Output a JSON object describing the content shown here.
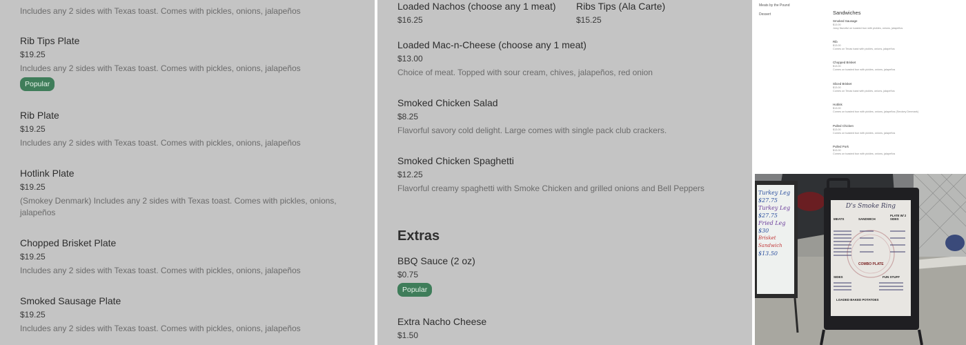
{
  "left_panel": {
    "top_desc": "Includes any 2 sides with Texas toast. Comes with pickles, onions, jalapeños",
    "items": [
      {
        "name": "Rib Tips Plate",
        "price": "$19.25",
        "desc": "Includes any 2 sides with Texas toast. Comes with pickles, onions, jalapeños",
        "badge": "Popular"
      },
      {
        "name": "Rib Plate",
        "price": "$19.25",
        "desc": "Includes any 2 sides with Texas toast. Comes with pickles, onions, jalapeños"
      },
      {
        "name": "Hotlink Plate",
        "price": "$19.25",
        "desc": "(Smokey Denmark) Includes any 2 sides with Texas toast. Comes with pickles, onions, jalapeños"
      },
      {
        "name": "Chopped Brisket Plate",
        "price": "$19.25",
        "desc": "Includes any 2 sides with Texas toast. Comes with pickles, onions, jalapeños"
      },
      {
        "name": "Smoked Sausage Plate",
        "price": "$19.25",
        "desc": "Includes any 2 sides with Texas toast. Comes with pickles, onions, jalapeños"
      }
    ]
  },
  "middle_panel": {
    "pair": [
      {
        "name": "Loaded Nachos (choose any 1 meat)",
        "price": "$16.25"
      },
      {
        "name": "Ribs Tips (Ala Carte)",
        "price": "$15.25"
      }
    ],
    "items": [
      {
        "name": "Loaded Mac-n-Cheese (choose any 1 meat)",
        "price": "$13.00",
        "desc": "Choice of meat. Topped with sour cream, chives, jalapeños, red onion"
      },
      {
        "name": "Smoked Chicken Salad",
        "price": "$8.25",
        "desc": "Flavorful savory cold delight. Large comes with single pack club crackers."
      },
      {
        "name": "Smoked Chicken Spaghetti",
        "price": "$12.25",
        "desc": "Flavorful creamy spaghetti with Smoke Chicken and grilled onions and Bell Peppers"
      }
    ],
    "section_title": "Extras",
    "extras": [
      {
        "name": "BBQ Sauce (2 oz)",
        "price": "$0.75",
        "badge": "Popular"
      },
      {
        "name": "Extra Nacho Cheese",
        "price": "$1.50"
      }
    ]
  },
  "thumbnail": {
    "categories": [
      "Meats by the Pound",
      "Dessert"
    ],
    "title": "Sandwiches",
    "items": [
      {
        "name": "Smoked Sausage",
        "price": "$13.00",
        "desc": "Juicy flavorful on toasted bun with pickles, onions, jalapeños"
      },
      {
        "name": "Rib",
        "price": "$13.00",
        "desc": "Comes on Texas toast with pickles, onions, jalapeños"
      },
      {
        "name": "Chopped Brisket",
        "price": "$13.00",
        "desc": "Comes on toasted bun with pickles, onions, jalapeños"
      },
      {
        "name": "Sliced Brisket",
        "price": "$13.00",
        "desc": "Comes on Texas toast with pickles, onions, jalapeños"
      },
      {
        "name": "Hotlink",
        "price": "$13.00",
        "desc": "Comes on toasted bun with pickles, onions, jalapeños (Smokey Denmark)"
      },
      {
        "name": "Pulled Chicken",
        "price": "$13.00",
        "desc": "Comes on toasted bun with pickles, onions, jalapeños"
      },
      {
        "name": "Pulled Pork",
        "price": "$13.00",
        "desc": "Comes on toasted bun with pickles, onions, jalapeños"
      }
    ]
  },
  "photo": {
    "whiteboard_lines": [
      "Turkey Leg",
      "$27.75",
      "Turkey Leg",
      "$27.75",
      "Fried Leg",
      "$30",
      "Brisket Sandwich",
      "$13.50"
    ],
    "sign_title": "D's Smoke Ring",
    "sign_headers": [
      "MEATS",
      "SANDWICH",
      "PLATE W/ 2 SIDES"
    ],
    "sign_sections": [
      "COMBO PLATE",
      "SIDES",
      "FUN STUFF",
      "LOADED BAKED POTATOES"
    ]
  }
}
